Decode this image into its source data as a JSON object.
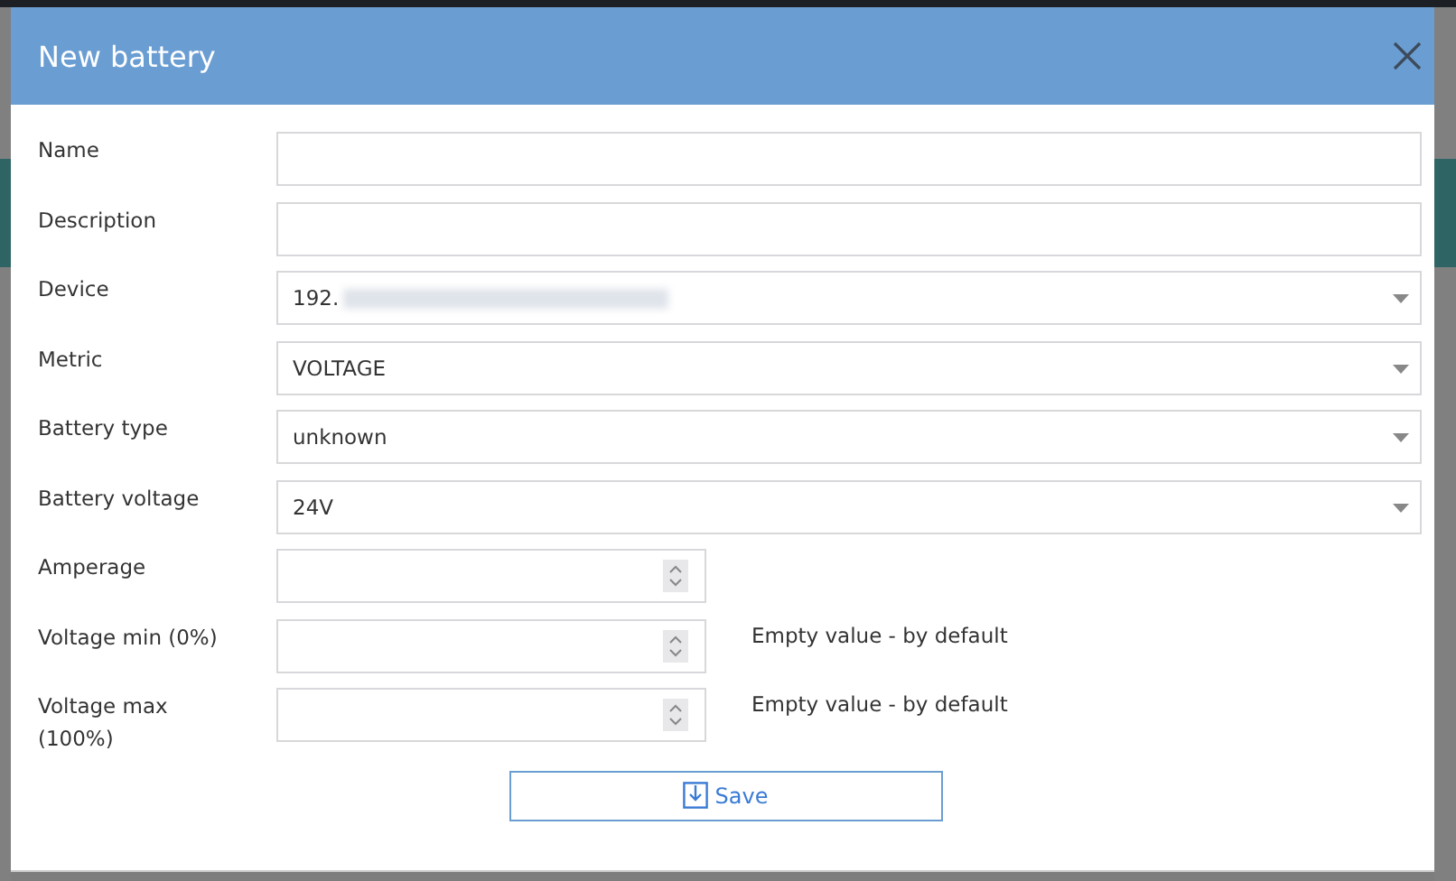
{
  "dialog": {
    "title": "New battery"
  },
  "fields": [
    {
      "label": "Name",
      "kind": "text"
    },
    {
      "label": "Description",
      "kind": "text"
    },
    {
      "label": "Device",
      "kind": "select",
      "value": "192.",
      "redacted": true
    },
    {
      "label": "Metric",
      "kind": "select",
      "value": "VOLTAGE"
    },
    {
      "label": "Battery type",
      "kind": "select",
      "value": "unknown"
    },
    {
      "label": "Battery voltage",
      "kind": "select",
      "value": "24V"
    },
    {
      "label": "Amperage",
      "kind": "number"
    },
    {
      "label": "Voltage min (0%)",
      "kind": "number",
      "hint": "Empty value - by default"
    },
    {
      "label": "Voltage max (100%)",
      "kind": "number",
      "hint": "Empty value - by default"
    }
  ],
  "save_button": {
    "label": "Save"
  }
}
